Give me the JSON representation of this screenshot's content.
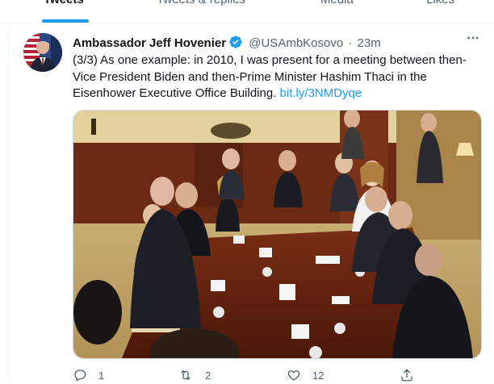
{
  "tabs": [
    {
      "label": "Tweets",
      "active": true
    },
    {
      "label": "Tweets & replies",
      "active": false
    },
    {
      "label": "Media",
      "active": false
    },
    {
      "label": "Likes",
      "active": false
    }
  ],
  "tweet": {
    "display_name": "Ambassador Jeff Hovenier",
    "verified": true,
    "handle": "@USAmbKosovo",
    "separator": "·",
    "time": "23m",
    "more_icon": "more-horizontal-icon",
    "text": "(3/3) As one example: in 2010, I was present for a meeting between then-Vice President Biden and then-Prime Minister Hashim Thaci in the Eisenhower Executive Office Building. ",
    "link": "bit.ly/3NMDyqe",
    "media_icon": "photo",
    "actions": {
      "reply_count": "1",
      "retweet_count": "2",
      "like_count": "12"
    }
  },
  "colors": {
    "accent": "#1d9bf0",
    "secondary_text": "#536471",
    "border": "#cfd9de"
  }
}
